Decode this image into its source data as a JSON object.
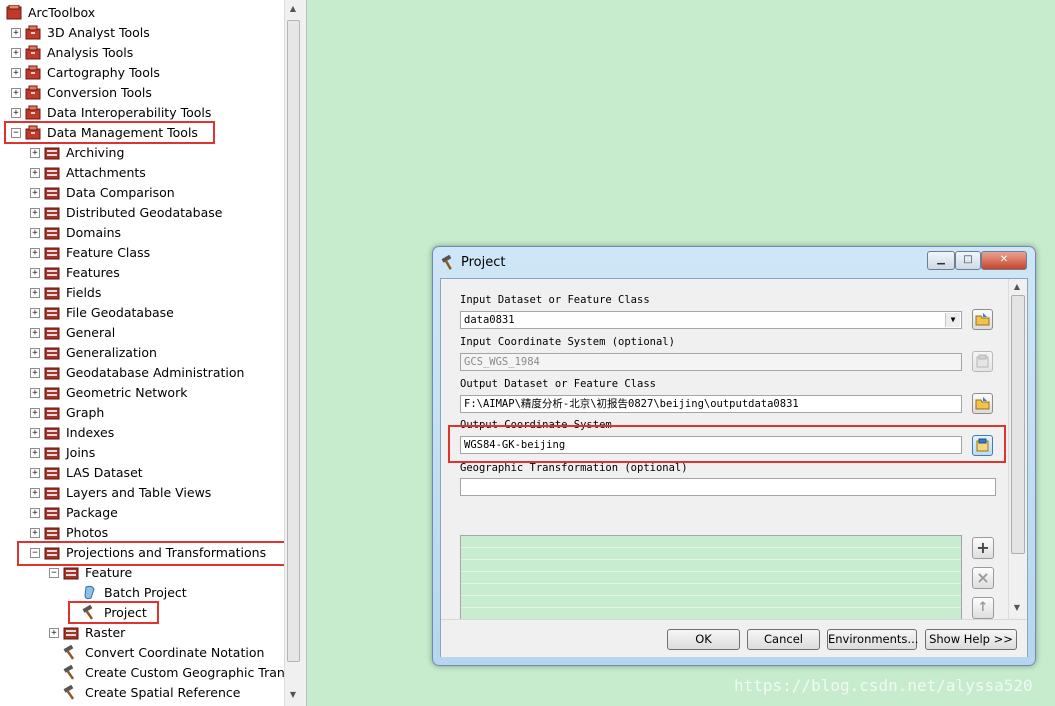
{
  "toolbox": {
    "root_label": "ArcToolbox",
    "items": [
      {
        "label": "3D Analyst Tools",
        "exp": "+"
      },
      {
        "label": "Analysis Tools",
        "exp": "+"
      },
      {
        "label": "Cartography Tools",
        "exp": "+"
      },
      {
        "label": "Conversion Tools",
        "exp": "+"
      },
      {
        "label": "Data Interoperability Tools",
        "exp": "+"
      },
      {
        "label": "Data Management Tools",
        "exp": "−"
      },
      {
        "label": "Archiving",
        "exp": "+"
      },
      {
        "label": "Attachments",
        "exp": "+"
      },
      {
        "label": "Data Comparison",
        "exp": "+"
      },
      {
        "label": "Distributed Geodatabase",
        "exp": "+"
      },
      {
        "label": "Domains",
        "exp": "+"
      },
      {
        "label": "Feature Class",
        "exp": "+"
      },
      {
        "label": "Features",
        "exp": "+"
      },
      {
        "label": "Fields",
        "exp": "+"
      },
      {
        "label": "File Geodatabase",
        "exp": "+"
      },
      {
        "label": "General",
        "exp": "+"
      },
      {
        "label": "Generalization",
        "exp": "+"
      },
      {
        "label": "Geodatabase Administration",
        "exp": "+"
      },
      {
        "label": "Geometric Network",
        "exp": "+"
      },
      {
        "label": "Graph",
        "exp": "+"
      },
      {
        "label": "Indexes",
        "exp": "+"
      },
      {
        "label": "Joins",
        "exp": "+"
      },
      {
        "label": "LAS Dataset",
        "exp": "+"
      },
      {
        "label": "Layers and Table Views",
        "exp": "+"
      },
      {
        "label": "Package",
        "exp": "+"
      },
      {
        "label": "Photos",
        "exp": "+"
      },
      {
        "label": "Projections and Transformations",
        "exp": "−"
      },
      {
        "label": "Feature",
        "exp": "−"
      },
      {
        "label": "Batch Project",
        "exp": ""
      },
      {
        "label": "Project",
        "exp": ""
      },
      {
        "label": "Raster",
        "exp": "+"
      },
      {
        "label": "Convert Coordinate Notation",
        "exp": ""
      },
      {
        "label": "Create Custom Geographic Transf",
        "exp": ""
      },
      {
        "label": "Create Spatial Reference",
        "exp": ""
      }
    ]
  },
  "dialog": {
    "title": "Project",
    "input_dataset_label": "Input Dataset or Feature Class",
    "input_dataset_value": "data0831",
    "input_cs_label": "Input Coordinate System (optional)",
    "input_cs_value": "GCS_WGS_1984",
    "output_dataset_label": "Output Dataset or Feature Class",
    "output_dataset_value": "F:\\AIMAP\\精度分析-北京\\初报告0827\\beijing\\outputdata0831",
    "output_cs_label": "Output Coordinate System",
    "output_cs_value": "WGS84-GK-beijing",
    "geo_transform_label": "Geographic Transformation (optional)",
    "buttons": {
      "ok": "OK",
      "cancel": "Cancel",
      "environments": "Environments...",
      "show_help": "Show Help >>"
    }
  },
  "watermark": "https://blog.csdn.net/alyssa520"
}
